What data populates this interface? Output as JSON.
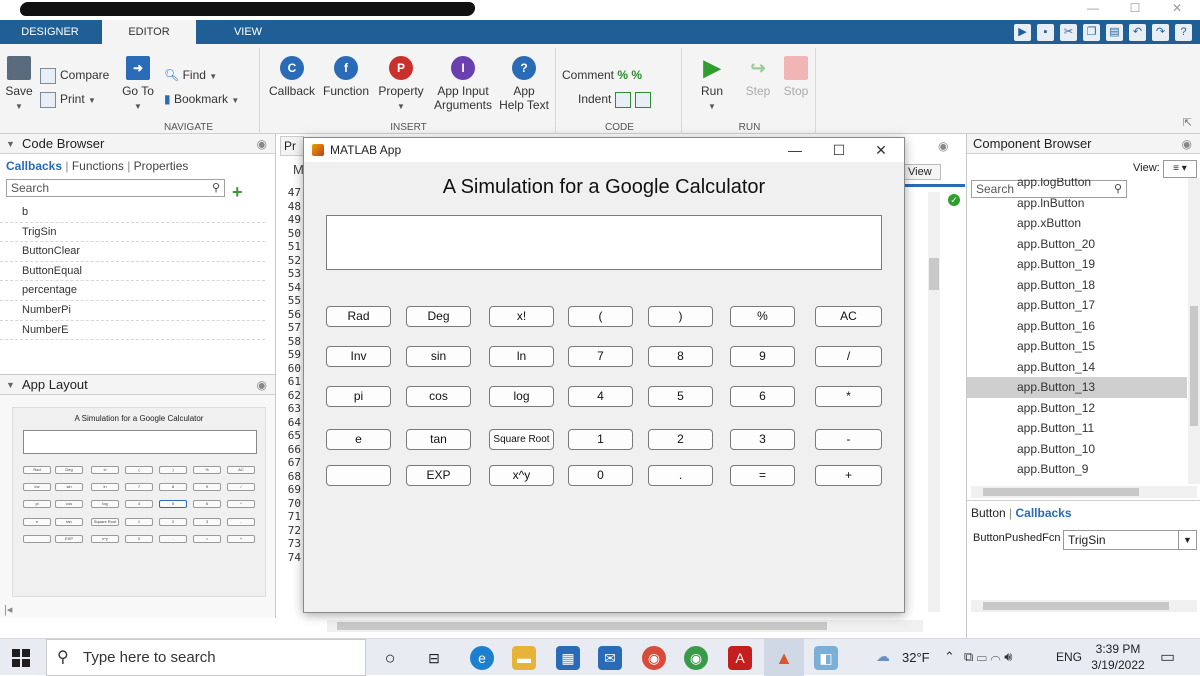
{
  "window": {
    "minimize_icon": "—",
    "maximize_icon": "☐",
    "close_icon": "✕"
  },
  "tabs": [
    "DESIGNER",
    "EDITOR",
    "VIEW"
  ],
  "ribbon": {
    "file": {
      "save": "Save",
      "compare": "Compare",
      "print": "Print"
    },
    "navigate": {
      "title": "NAVIGATE",
      "goto": "Go To",
      "find": "Find",
      "bookmark": "Bookmark"
    },
    "insert": {
      "title": "INSERT",
      "callback": "Callback",
      "function": "Function",
      "property": "Property",
      "app_input_1": "App Input",
      "app_input_2": "Arguments",
      "help_1": "App",
      "help_2": "Help Text",
      "callback_icon": "C",
      "function_icon": "f",
      "property_icon": "P",
      "input_icon": "I",
      "help_icon": "?"
    },
    "code": {
      "title": "CODE",
      "comment": "Comment",
      "indent": "Indent"
    },
    "run": {
      "title": "RUN",
      "run": "Run",
      "step": "Step",
      "stop": "Stop"
    }
  },
  "code_browser": {
    "title": "Code Browser",
    "tabs": [
      "Callbacks",
      "Functions",
      "Properties"
    ],
    "search_placeholder": "Search",
    "items": [
      "b",
      "TrigSin",
      "ButtonClear",
      "ButtonEqual",
      "percentage",
      "NumberPi",
      "NumberE"
    ]
  },
  "app_layout": {
    "title": "App Layout",
    "preview_title": "A Simulation for a Google Calculator",
    "buttons": [
      "Rad",
      "Deg",
      "x!",
      "(",
      ")",
      "%",
      "AC",
      "Inv",
      "sin",
      "ln",
      "7",
      "8",
      "9",
      "/",
      "pi",
      "cos",
      "log",
      "4",
      "5",
      "6",
      "*",
      "e",
      "tan",
      "Square Root",
      "1",
      "2",
      "3",
      "-",
      "",
      "EXP",
      "x^y",
      "0",
      ".",
      "=",
      "+"
    ]
  },
  "editor": {
    "tab_partial": "Pr",
    "partial_M": "M",
    "view_button": "View",
    "line_numbers": [
      "47",
      "48",
      "49",
      "50",
      "51",
      "52",
      "53",
      "54",
      "55",
      "56",
      "57",
      "58",
      "59",
      "60",
      "61",
      "62",
      "63",
      "64",
      "65",
      "66",
      "67",
      "68",
      "69",
      "70",
      "71",
      "72",
      "73",
      "74"
    ]
  },
  "app": {
    "window_title": "MATLAB App",
    "title": "A Simulation for a Google Calculator",
    "display_value": "",
    "buttons": [
      "Rad",
      "Deg",
      "x!",
      "(",
      ")",
      "%",
      "AC",
      "Inv",
      "sin",
      "ln",
      "7",
      "8",
      "9",
      "/",
      "pi",
      "cos",
      "log",
      "4",
      "5",
      "6",
      "*",
      "e",
      "tan",
      "Square Root",
      "1",
      "2",
      "3",
      "-",
      "",
      "EXP",
      "x^y",
      "0",
      ".",
      "=",
      "+"
    ]
  },
  "component_browser": {
    "title": "Component Browser",
    "search_placeholder": "Search",
    "view_label": "View:",
    "items": [
      "app.logButton",
      "app.lnButton",
      "app.xButton",
      "app.Button_20",
      "app.Button_19",
      "app.Button_18",
      "app.Button_17",
      "app.Button_16",
      "app.Button_15",
      "app.Button_14",
      "app.Button_13",
      "app.Button_12",
      "app.Button_11",
      "app.Button_10",
      "app.Button_9"
    ],
    "selected": "app.Button_13",
    "inspector_tabs": [
      "Button",
      "Callbacks"
    ],
    "property_name": "ButtonPushedFcn",
    "property_value": "TrigSin"
  },
  "taskbar": {
    "search_placeholder": "Type here to search",
    "weather": "32°F",
    "language": "ENG",
    "time": "3:39 PM",
    "date": "3/19/2022"
  },
  "colors": {
    "tab_bar": "#1f5f96",
    "selection": "#cfcfcf",
    "accent": "#2a6bb8"
  }
}
